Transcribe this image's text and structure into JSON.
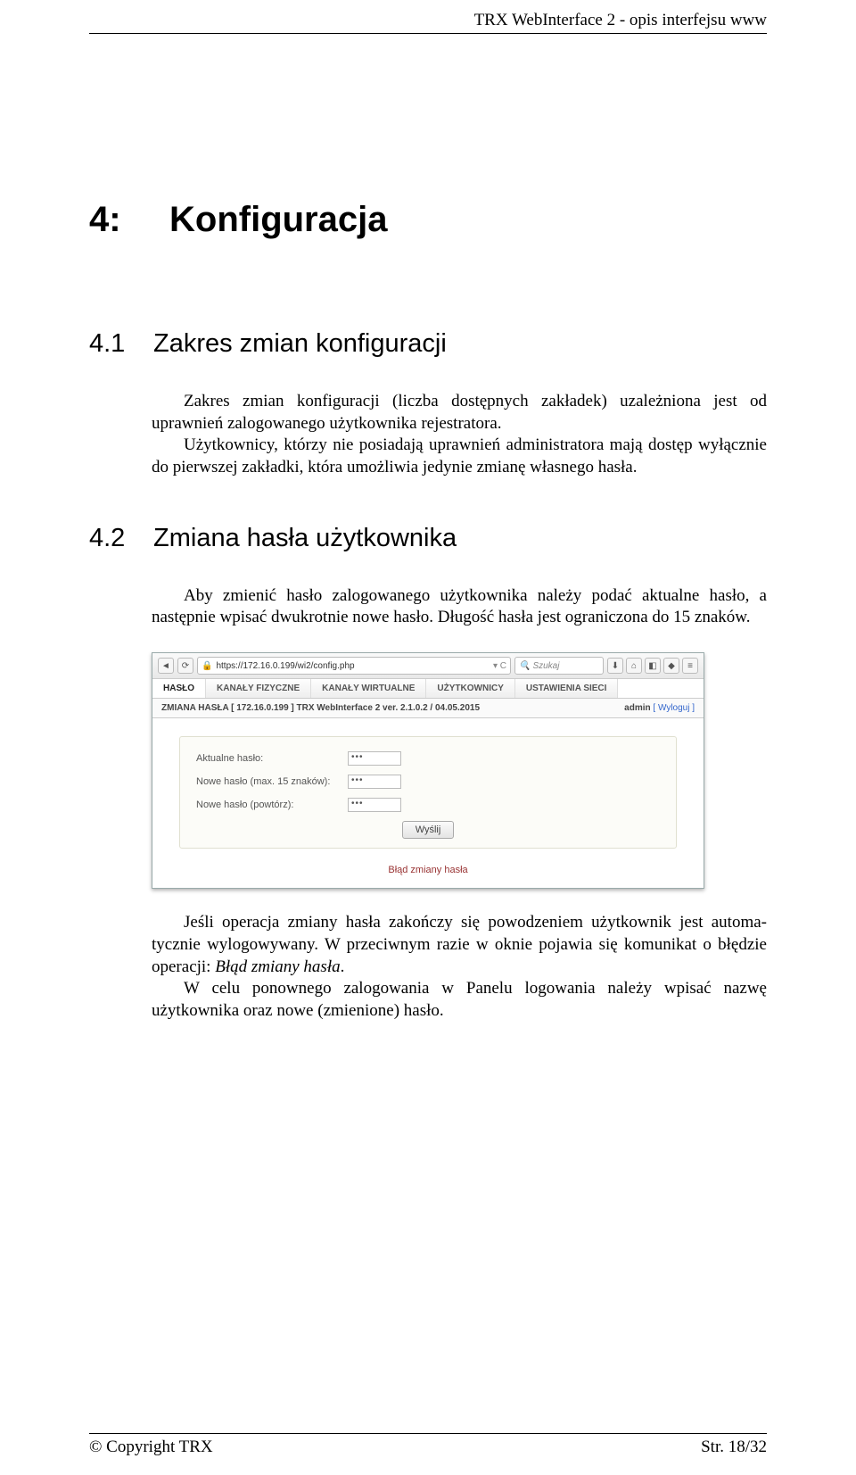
{
  "header": {
    "title": "TRX WebInterface 2 - opis interfejsu www"
  },
  "sections": {
    "h1_num": "4:",
    "h1_title": "Konfiguracja",
    "s41_num": "4.1",
    "s41_title": "Zakres zmian konfiguracji",
    "s41_p1": "Zakres zmian konfiguracji (liczba dostępnych zakładek) uzależniona jest od uprawnień zalogowanego użytkownika rejestratora.",
    "s41_p2": "Użytkownicy, którzy nie posiadają uprawnień administratora mają dostęp wy­łącznie do pierwszej zakładki, która umożliwia jedynie zmianę własnego hasła.",
    "s42_num": "4.2",
    "s42_title": "Zmiana hasła użytkownika",
    "s42_p1": "Aby zmienić hasło zalogowanego użytkownika należy podać aktualne hasło, a następnie wpisać dwukrotnie nowe hasło. Długość hasła jest ograniczona do 15 znaków.",
    "s42_p2a": "Jeśli operacja zmiany hasła zakończy się powodzeniem użytkownik jest automa­tycznie wylogowywany. W przeciwnym razie w oknie pojawia się komunikat o błędzie operacji: ",
    "s42_p2b": "Błąd zmiany hasła",
    "s42_p2c": ".",
    "s42_p3": "W celu ponownego zalogowania w Panelu logowania należy wpisać nazwę użytkownika oraz nowe (zmienione) hasło."
  },
  "browser": {
    "url": "https://172.16.0.199/wi2/config.php",
    "search_placeholder": "Szukaj"
  },
  "tabs": {
    "t1": "HASŁO",
    "t2": "KANAŁY FIZYCZNE",
    "t3": "KANAŁY WIRTUALNE",
    "t4": "UŻYTKOWNICY",
    "t5": "USTAWIENIA SIECI"
  },
  "subheader": {
    "left": "ZMIANA HASŁA  [ 172.16.0.199 ]   TRX WebInterface 2 ver. 2.1.0.2 / 04.05.2015",
    "user": "admin",
    "logout": "[ Wyloguj ]"
  },
  "form": {
    "current_label": "Aktualne hasło:",
    "new_label": "Nowe hasło (max. 15 znaków):",
    "repeat_label": "Nowe hasło (powtórz):",
    "pw_mask": "•••",
    "submit": "Wyślij",
    "error": "Błąd zmiany hasła"
  },
  "footer": {
    "left": "© Copyright TRX",
    "right": "Str. 18/32"
  }
}
